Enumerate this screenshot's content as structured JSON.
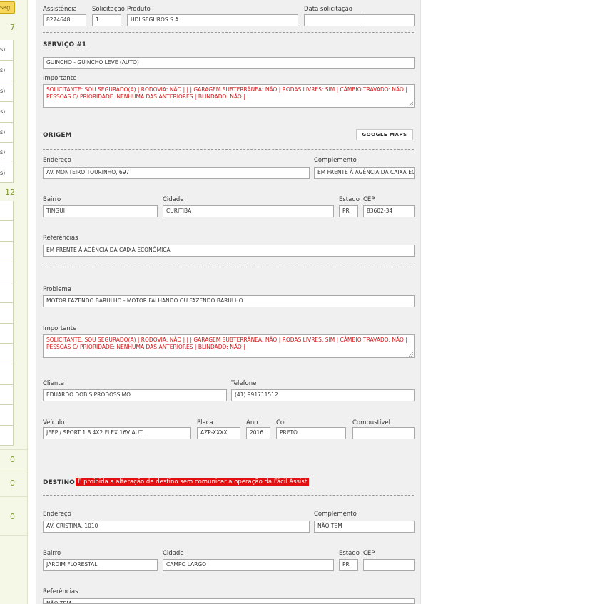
{
  "left_panel": {
    "badge": "seg",
    "count_top": "7",
    "row_suffix": "s)",
    "count_mid": "12",
    "count_a": "0",
    "count_b": "0",
    "count_c": "0"
  },
  "header": {
    "assistencia_label": "Assistência",
    "assistencia_value": "8274648",
    "solicitacao_label": "Solicitação",
    "solicitacao_value": "1",
    "produto_label": "Produto",
    "produto_value": "HDI SEGUROS S.A",
    "data_label": "Data solicitação",
    "data_value_a": "",
    "data_value_b": ""
  },
  "servico": {
    "title": "SERVIÇO #1",
    "value": "GUINCHO - GUINCHO LEVE (AUTO)",
    "importante_label": "Importante",
    "importante_text": "SOLICITANTE: SOU SEGURADO(A) | RODOVIA: NÃO | | | GARAGEM SUBTERRÂNEA: NÃO | RODAS LIVRES: SIM | CÂMBIO TRAVADO: NÃO | PESSOAS C/ PRIORIDADE: NENHUMA DAS ANTERIORES | BLINDADO: NÃO |"
  },
  "origem": {
    "title": "ORIGEM",
    "maps_button": "GOOGLE MAPS",
    "endereco_label": "Endereço",
    "endereco_value": "AV. MONTEIRO TOURINHO, 697",
    "complemento_label": "Complemento",
    "complemento_value": "EM FRENTE À AGÊNCIA DA CAIXA EC",
    "bairro_label": "Bairro",
    "bairro_value": "TINGUI",
    "cidade_label": "Cidade",
    "cidade_value": "CURITIBA",
    "estado_label": "Estado",
    "estado_value": "PR",
    "cep_label": "CEP",
    "cep_value": "83602-34",
    "referencias_label": "Referências",
    "referencias_value": "EM FRENTE À AGÊNCIA DA CAIXA ECONÔMICA"
  },
  "problema": {
    "label": "Problema",
    "value": "MOTOR FAZENDO BARULHO - MOTOR FALHANDO OU FAZENDO BARULHO",
    "importante_label": "Importante",
    "importante_text": "SOLICITANTE: SOU SEGURADO(A) | RODOVIA: NÃO | | | GARAGEM SUBTERRÂNEA: NÃO | RODAS LIVRES: SIM | CÂMBIO TRAVADO: NÃO | PESSOAS C/ PRIORIDADE: NENHUMA DAS ANTERIORES | BLINDADO: NÃO |"
  },
  "cliente": {
    "cliente_label": "Cliente",
    "cliente_value": "EDUARDO DOBIS PRODOSSIMO",
    "telefone_label": "Telefone",
    "telefone_value": "(41) 991711512"
  },
  "veiculo": {
    "veiculo_label": "Veículo",
    "veiculo_value": "JEEP / SPORT 1.8 4X2 FLEX 16V AUT.",
    "placa_label": "Placa",
    "placa_value": "AZP-XXXX",
    "ano_label": "Ano",
    "ano_value": "2016",
    "cor_label": "Cor",
    "cor_value": "PRETO",
    "combustivel_label": "Combustível",
    "combustivel_value": ""
  },
  "destino": {
    "title": "DESTINO",
    "warning": "É proibida a alteração de destino sem comunicar a operação da Fácil Assist",
    "endereco_label": "Endereço",
    "endereco_value": "AV. CRISTINA, 1010",
    "complemento_label": "Complemento",
    "complemento_value": "NÃO TEM",
    "bairro_label": "Bairro",
    "bairro_value": "JARDIM FLORESTAL",
    "cidade_label": "Cidade",
    "cidade_value": "CAMPO LARGO",
    "estado_label": "Estado",
    "estado_value": "PR",
    "cep_label": "CEP",
    "cep_value": "",
    "referencias_label": "Referências",
    "referencias_value": "NÃO TEM"
  },
  "colors": {
    "warning_bg": "#e10f0f",
    "important_text": "#d01818",
    "left_panel_accent": "#7d9a2a",
    "badge_bg": "#f7d75a"
  }
}
